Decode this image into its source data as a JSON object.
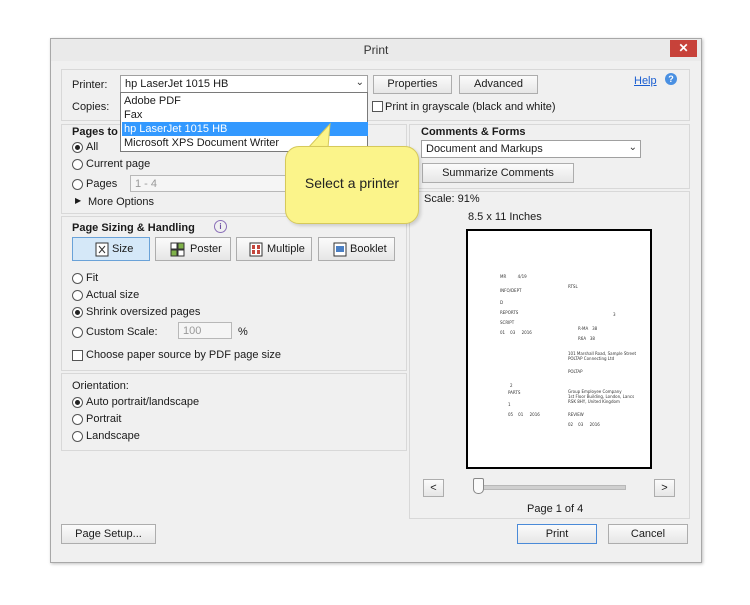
{
  "window": {
    "title": "Print",
    "close_glyph": "✕"
  },
  "printer": {
    "label": "Printer:",
    "selected": "hp LaserJet 1015 HB",
    "options": [
      "Adobe PDF",
      "Fax",
      "hp LaserJet 1015 HB",
      "Microsoft XPS Document Writer"
    ],
    "properties_label": "Properties",
    "advanced_label": "Advanced",
    "help_label": "Help"
  },
  "copies": {
    "label": "Copies:",
    "grayscale_label": "Print in grayscale (black and white)",
    "grayscale_checked": false
  },
  "tooltip": {
    "text": "Select a printer"
  },
  "pages_to_print": {
    "title": "Pages to Pr",
    "all_label": "All",
    "current_label": "Current page",
    "pages_label": "Pages",
    "pages_placeholder": "1 - 4",
    "more_options_label": "More Options",
    "selected": "All"
  },
  "sizing": {
    "title": "Page Sizing & Handling",
    "tabs": [
      "Size",
      "Poster",
      "Multiple",
      "Booklet"
    ],
    "active_tab": "Size",
    "fit_label": "Fit",
    "actual_label": "Actual size",
    "shrink_label": "Shrink oversized pages",
    "custom_label": "Custom Scale:",
    "custom_value": "100",
    "percent_sign": "%",
    "paper_source_label": "Choose paper source by PDF page size",
    "selected": "Shrink oversized pages"
  },
  "orientation": {
    "title": "Orientation:",
    "auto_label": "Auto portrait/landscape",
    "portrait_label": "Portrait",
    "landscape_label": "Landscape",
    "selected": "Auto portrait/landscape"
  },
  "comments": {
    "title": "Comments & Forms",
    "selected": "Document and Markups",
    "summarize_label": "Summarize Comments"
  },
  "preview": {
    "scale_label": "Scale: 91%",
    "paper_size": "8.5 x 11 Inches",
    "page_indicator": "Page 1 of 4",
    "prev_glyph": "<",
    "next_glyph": ">",
    "slider_fraction": 0.0
  },
  "footer": {
    "page_setup_label": "Page Setup...",
    "print_label": "Print",
    "cancel_label": "Cancel"
  },
  "colors": {
    "accent": "#3399ff",
    "close": "#c7423a",
    "tooltip": "#fbf48a",
    "help_icon": "#4a90e2"
  }
}
